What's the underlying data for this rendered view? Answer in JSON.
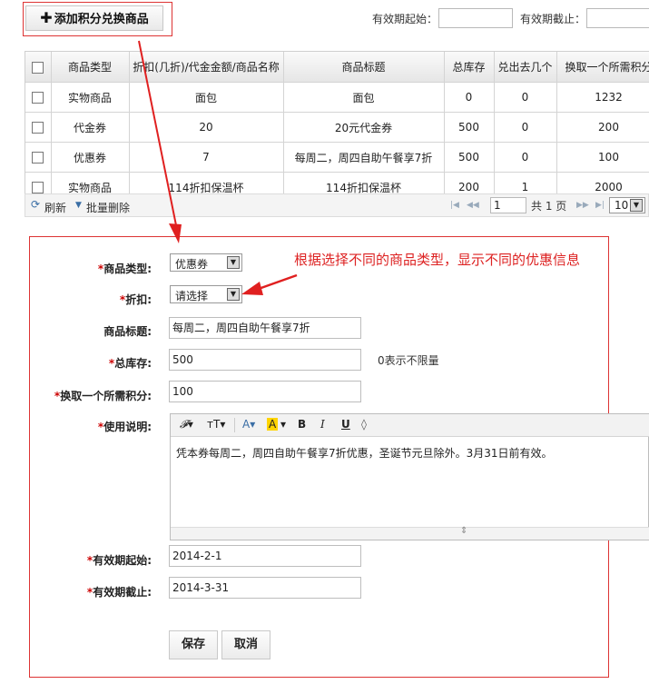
{
  "top": {
    "add_button_label": "添加积分兑换商品",
    "valid_from_label": "有效期起始：",
    "valid_to_label": "有效期截止："
  },
  "table": {
    "headers": [
      "商品类型",
      "折扣(几折)/代金金额/商品名称",
      "商品标题",
      "总库存",
      "兑出去几个",
      "换取一个所需积分"
    ],
    "rows": [
      [
        "实物商品",
        "面包",
        "面包",
        "0",
        "0",
        "1232"
      ],
      [
        "代金券",
        "20",
        "20元代金券",
        "500",
        "0",
        "200"
      ],
      [
        "优惠券",
        "7",
        "每周二，周四自助午餐享7折",
        "500",
        "0",
        "100"
      ],
      [
        "实物商品",
        "114折扣保温杯",
        "114折扣保温杯",
        "200",
        "1",
        "2000"
      ]
    ]
  },
  "toolbar": {
    "refresh": "刷新",
    "batch_delete": "批量删除",
    "page_input": "1",
    "page_total": "共 1 页",
    "page_size": "10"
  },
  "form": {
    "type_label": "商品类型:",
    "type_value": "优惠券",
    "discount_label": "折扣:",
    "discount_value": "请选择",
    "title_label": "商品标题:",
    "title_value": "每周二，周四自助午餐享7折",
    "stock_label": "总库存:",
    "stock_value": "500",
    "stock_hint": "0表示不限量",
    "points_label": "换取一个所需积分:",
    "points_value": "100",
    "usage_label": "使用说明:",
    "usage_text": "凭本券每周二，周四自助午餐享7折优惠，圣诞节元旦除外。3月31日前有效。",
    "valid_from_label": "有效期起始:",
    "valid_from_value": "2014-2-1",
    "valid_to_label": "有效期截止:",
    "valid_to_value": "2014-3-31",
    "save_label": "保存",
    "cancel_label": "取消"
  },
  "annotation": "根据选择不同的商品类型，显示不同的优惠信息",
  "colors": {
    "annotation_red": "#dd2222",
    "link_blue": "#3a6ea5"
  },
  "icons": [
    "plus-icon",
    "refresh-icon",
    "triangle-down-icon",
    "page-first-icon",
    "page-prev-icon",
    "page-next-icon",
    "page-last-icon",
    "font-family-icon",
    "font-size-icon",
    "font-color-icon",
    "highlight-icon",
    "bold-icon",
    "italic-icon",
    "underline-icon",
    "eraser-icon",
    "resize-handle-icon"
  ]
}
